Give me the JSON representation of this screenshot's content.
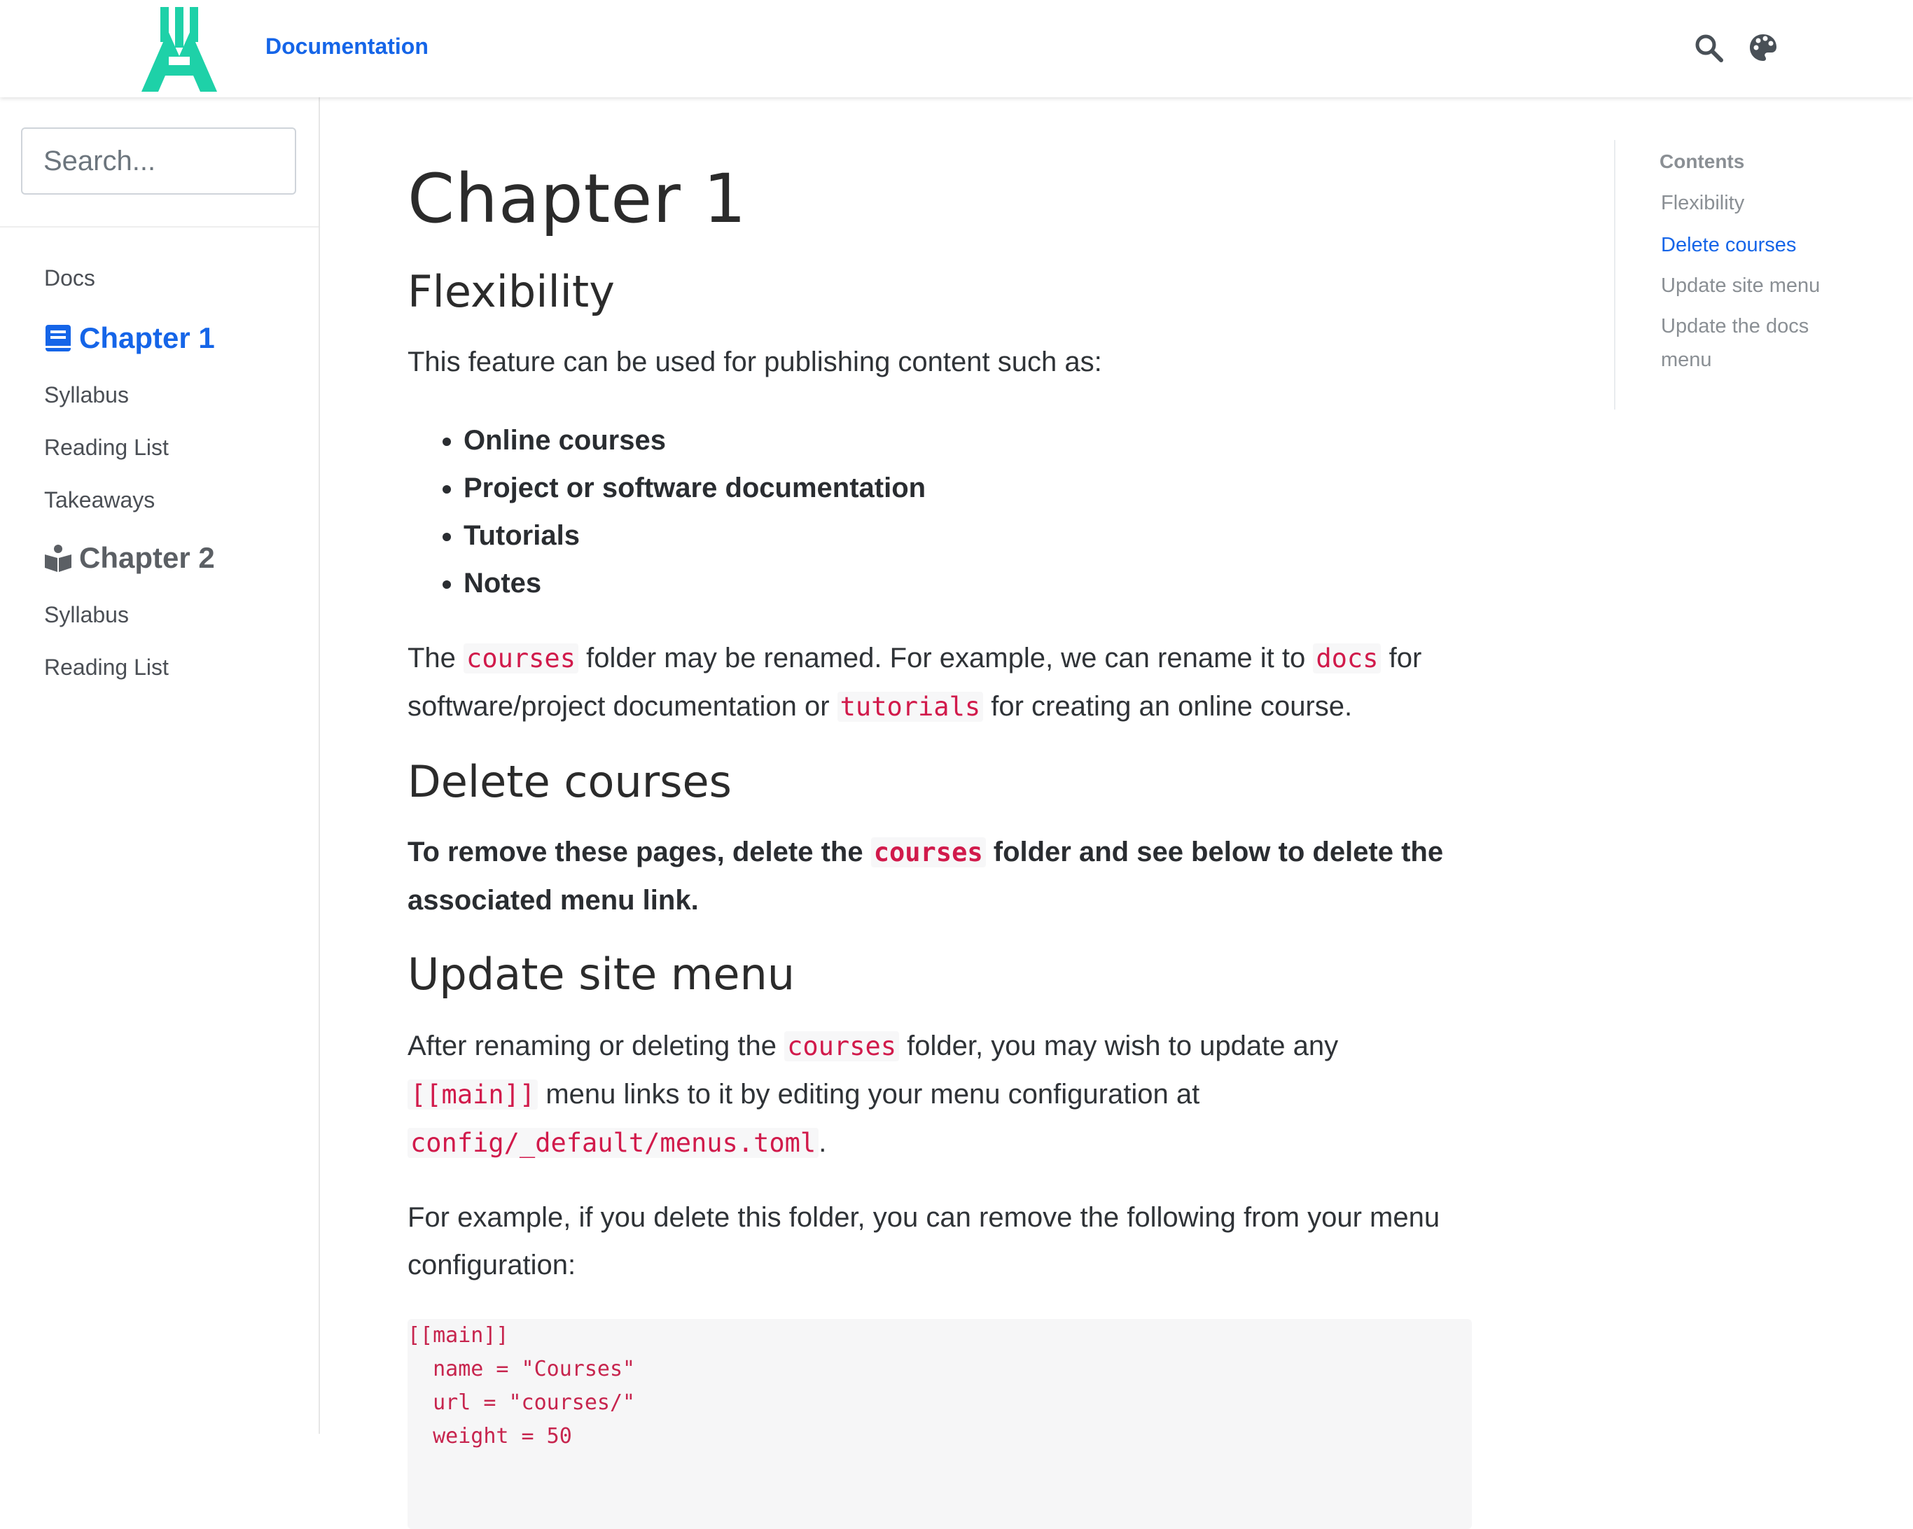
{
  "navbar": {
    "brand": "Documentation",
    "search_icon": "search-icon",
    "palette_icon": "palette-icon",
    "accent": "#1565e8",
    "logo_color": "#1ed1a8"
  },
  "sidebar": {
    "search_placeholder": "Search...",
    "docs_label": "Docs",
    "chapter1": {
      "label": "Chapter 1",
      "icon": "book-icon"
    },
    "chapter1_items": [
      "Syllabus",
      "Reading List",
      "Takeaways"
    ],
    "chapter2": {
      "label": "Chapter 2",
      "icon": "reader-icon"
    },
    "chapter2_items": [
      "Syllabus",
      "Reading List"
    ]
  },
  "article": {
    "title": "Chapter 1",
    "flexibility": {
      "heading": "Flexibility",
      "intro": "This feature can be used for publishing content such as:",
      "list": [
        "Online courses",
        "Project or software documentation",
        "Tutorials",
        "Notes"
      ],
      "p_t1": "The ",
      "p_c1": "courses",
      "p_t2": " folder may be renamed. For example, we can rename it to ",
      "p_c2": "docs",
      "p_t3": " for software/project documentation or ",
      "p_c3": "tutorials",
      "p_t4": " for creating an online course."
    },
    "delete": {
      "heading": "Delete courses",
      "t1": "To remove these pages, delete the ",
      "c1": "courses",
      "t2": " folder and see below to delete the associated menu link."
    },
    "update_menu": {
      "heading": "Update site menu",
      "t1": "After renaming or deleting the ",
      "c1": "courses",
      "t2": " folder, you may wish to update any ",
      "c2": "[[main]]",
      "t3": " menu links to it by editing your menu configuration at ",
      "c3": "config/_default/menus.toml",
      "t4": ".",
      "p2": "For example, if you delete this folder, you can remove the following from your menu configuration:",
      "code": "[[main]]\n  name = \"Courses\"\n  url = \"courses/\"\n  weight = 50"
    }
  },
  "toc": {
    "title": "Contents",
    "links": [
      "Flexibility",
      "Delete courses",
      "Update site menu",
      "Update the docs menu"
    ]
  }
}
